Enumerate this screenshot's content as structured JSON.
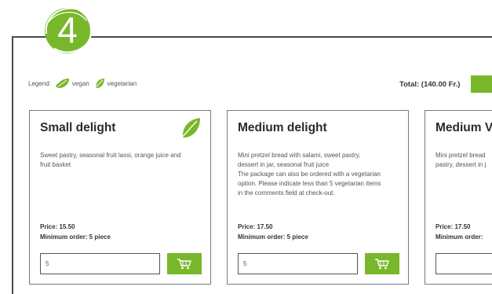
{
  "step": {
    "number": "4"
  },
  "legend": {
    "label": "Legend:",
    "vegan_label": "vegan",
    "vegetarian_label": "vegetarian"
  },
  "cart_summary": {
    "total_text": "Total: (140.00 Fr.)"
  },
  "colors": {
    "accent": "#78b72a",
    "frame": "#4a4a4a",
    "text": "#2b2b2b"
  },
  "packages": [
    {
      "title": "Small delight",
      "badge_icon": "vegetarian-leaf-icon",
      "description": [
        "Sweet pastry, seasonal fruit lassi, orange juice and",
        "fruit basket"
      ],
      "price": "Price: 15.50",
      "min_order": "Minimum order: 5 piece",
      "quantity": "5"
    },
    {
      "title": "Medium delight",
      "description": [
        "Mini pretzel bread with salami, sweet pastry,",
        "dessert in jar, seasonal fruit juice",
        "The package can also be ordered with a vegetarian",
        "option. Please indicate less than 5 vegetarian items",
        "in the comments field at check-out."
      ],
      "price": "Price: 17.50",
      "min_order": "Minimum order: 5 piece",
      "quantity": "5"
    },
    {
      "title": "Medium Vi",
      "description": [
        "Mini pretzel bread",
        "pastry, dessert in j"
      ],
      "price": "Price: 17.50",
      "min_order": "Minimum order:",
      "quantity": ""
    }
  ]
}
